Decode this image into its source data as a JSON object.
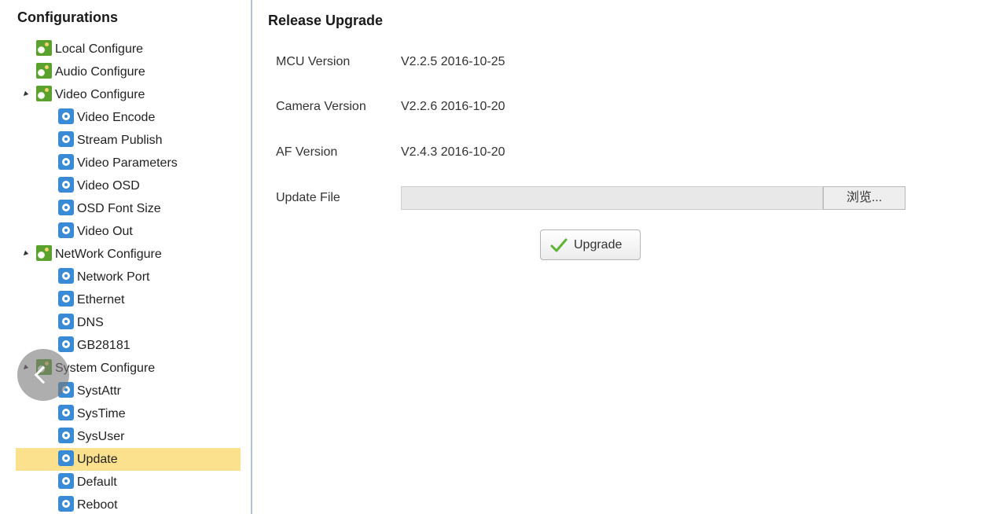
{
  "sidebar": {
    "title": "Configurations",
    "items": [
      {
        "label": "Local Configure",
        "level": 1,
        "icon": "gear-group-icon",
        "expanded": false
      },
      {
        "label": "Audio Configure",
        "level": 1,
        "icon": "gear-group-icon",
        "expanded": false
      },
      {
        "label": "Video Configure",
        "level": 1,
        "icon": "gear-group-icon",
        "expanded": true
      },
      {
        "label": "Video Encode",
        "level": 2,
        "icon": "gear-icon"
      },
      {
        "label": "Stream Publish",
        "level": 2,
        "icon": "gear-icon"
      },
      {
        "label": "Video Parameters",
        "level": 2,
        "icon": "gear-icon"
      },
      {
        "label": "Video OSD",
        "level": 2,
        "icon": "gear-icon"
      },
      {
        "label": "OSD Font Size",
        "level": 2,
        "icon": "gear-icon"
      },
      {
        "label": "Video Out",
        "level": 2,
        "icon": "gear-icon"
      },
      {
        "label": "NetWork Configure",
        "level": 1,
        "icon": "gear-group-icon",
        "expanded": true
      },
      {
        "label": "Network Port",
        "level": 2,
        "icon": "gear-icon"
      },
      {
        "label": "Ethernet",
        "level": 2,
        "icon": "gear-icon"
      },
      {
        "label": "DNS",
        "level": 2,
        "icon": "gear-icon"
      },
      {
        "label": "GB28181",
        "level": 2,
        "icon": "gear-icon"
      },
      {
        "label": "System Configure",
        "level": 1,
        "icon": "gear-group-icon",
        "expanded": true
      },
      {
        "label": "SystAttr",
        "level": 2,
        "icon": "gear-icon"
      },
      {
        "label": "SysTime",
        "level": 2,
        "icon": "gear-icon"
      },
      {
        "label": "SysUser",
        "level": 2,
        "icon": "gear-icon"
      },
      {
        "label": "Update",
        "level": 2,
        "icon": "gear-icon",
        "selected": true
      },
      {
        "label": "Default",
        "level": 2,
        "icon": "gear-icon"
      },
      {
        "label": "Reboot",
        "level": 2,
        "icon": "gear-icon"
      }
    ]
  },
  "main": {
    "title": "Release Upgrade",
    "mcu": {
      "label": "MCU Version",
      "value": "V2.2.5 2016-10-25"
    },
    "camera": {
      "label": "Camera Version",
      "value": "V2.2.6 2016-10-20"
    },
    "af": {
      "label": "AF Version",
      "value": "V2.4.3 2016-10-20"
    },
    "update_file": {
      "label": "Update File",
      "value": "",
      "browse_label": "浏览..."
    },
    "upgrade_label": "Upgrade"
  },
  "colors": {
    "selected_bg": "#fbe08d",
    "sidebar_border": "#a9c4e2",
    "group_icon": "#5aa12e",
    "leaf_icon": "#3a8bd6",
    "check_icon": "#5cb531"
  }
}
